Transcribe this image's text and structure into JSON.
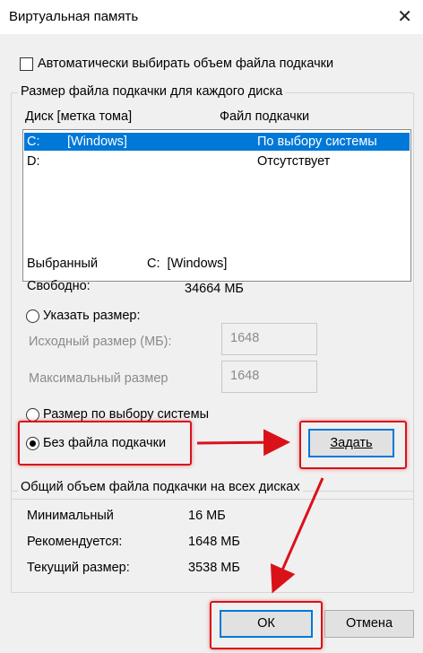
{
  "window": {
    "title": "Виртуальная память",
    "close_glyph": "✕"
  },
  "auto_manage": {
    "label": "Автоматически выбирать объем файла подкачки",
    "checked": false
  },
  "per_drive": {
    "legend": "Размер файла подкачки для каждого диска",
    "columns": {
      "drive": "Диск [метка тома]",
      "paging_file": "Файл подкачки"
    },
    "drives": [
      {
        "letter": "C:",
        "label": "[Windows]",
        "paging": "По выбору системы",
        "selected": true
      },
      {
        "letter": "D:",
        "label": "",
        "paging": "Отсутствует",
        "selected": false
      }
    ],
    "selected_label": "Выбранный",
    "selected_value": "C:  [Windows]",
    "free_label": "Свободно:",
    "free_value": "34664 МБ",
    "custom_size": {
      "label": "Указать размер:",
      "selected": false
    },
    "initial_size": {
      "label": "Исходный размер (МБ):",
      "value": "1648"
    },
    "max_size": {
      "label": "Максимальный размер",
      "value": "1648"
    },
    "system_managed": {
      "label": "Размер по выбору системы",
      "selected": false
    },
    "no_paging": {
      "label": "Без файла подкачки",
      "selected": true
    },
    "set_button": "Задать"
  },
  "total": {
    "legend": "Общий объем файла подкачки на всех дисках",
    "minimum_label": "Минимальный",
    "minimum_value": "16 МБ",
    "recommended_label": "Рекомендуется:",
    "recommended_value": "1648 МБ",
    "current_label": "Текущий размер:",
    "current_value": "3538 МБ"
  },
  "footer": {
    "ok_label": "ОК",
    "cancel_label": "Отмена"
  },
  "colors": {
    "highlight_red": "#d9121a",
    "selection_blue": "#0078d7",
    "dialog_bg": "#f0f0f0"
  }
}
